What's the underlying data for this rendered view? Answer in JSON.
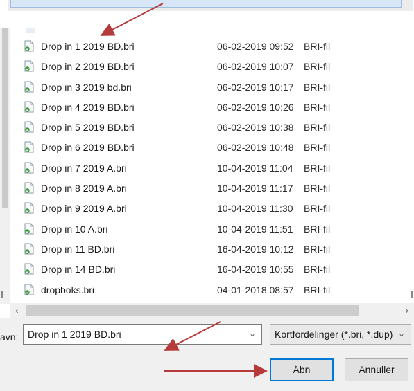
{
  "files": [
    {
      "name": "Drop in 1  2019 BD.bri",
      "date": "06-02-2019 09:52",
      "type": "BRI-fil"
    },
    {
      "name": "Drop in 2 2019 BD.bri",
      "date": "06-02-2019 10:07",
      "type": "BRI-fil"
    },
    {
      "name": "Drop in 3 2019 bd.bri",
      "date": "06-02-2019 10:17",
      "type": "BRI-fil"
    },
    {
      "name": "Drop in 4 2019 BD.bri",
      "date": "06-02-2019 10:26",
      "type": "BRI-fil"
    },
    {
      "name": "Drop in 5 2019 BD.bri",
      "date": "06-02-2019 10:38",
      "type": "BRI-fil"
    },
    {
      "name": "Drop in 6 2019 BD.bri",
      "date": "06-02-2019 10:48",
      "type": "BRI-fil"
    },
    {
      "name": "Drop in 7 2019 A.bri",
      "date": "10-04-2019 11:04",
      "type": "BRI-fil"
    },
    {
      "name": "Drop in 8 2019 A.bri",
      "date": "10-04-2019 11:17",
      "type": "BRI-fil"
    },
    {
      "name": "Drop in 9 2019 A.bri",
      "date": "10-04-2019 11:30",
      "type": "BRI-fil"
    },
    {
      "name": "Drop in 10 A.bri",
      "date": "10-04-2019 11:51",
      "type": "BRI-fil"
    },
    {
      "name": "Drop in 11 BD.bri",
      "date": "16-04-2019 10:12",
      "type": "BRI-fil"
    },
    {
      "name": "Drop in 14 BD.bri",
      "date": "16-04-2019 10:55",
      "type": "BRI-fil"
    },
    {
      "name": "dropboks.bri",
      "date": "04-01-2018 08:57",
      "type": "BRI-fil"
    }
  ],
  "filename": {
    "label": "avn:",
    "value": "Drop in 1  2019 BD.bri"
  },
  "filter": {
    "value": "Kortfordelinger (*.bri, *.dup)"
  },
  "buttons": {
    "open": "Åbn",
    "cancel": "Annuller"
  },
  "scroll": {
    "left_arrow": "‹",
    "right_arrow": "›",
    "chevron": "⌄"
  },
  "icons": {
    "file": "bri-file-icon",
    "annotation": "red-arrow-icon"
  },
  "colors": {
    "annotation_arrow": "#b73a3a",
    "focus_border": "#0078d7",
    "icon_badge": "#3a9a3a"
  }
}
